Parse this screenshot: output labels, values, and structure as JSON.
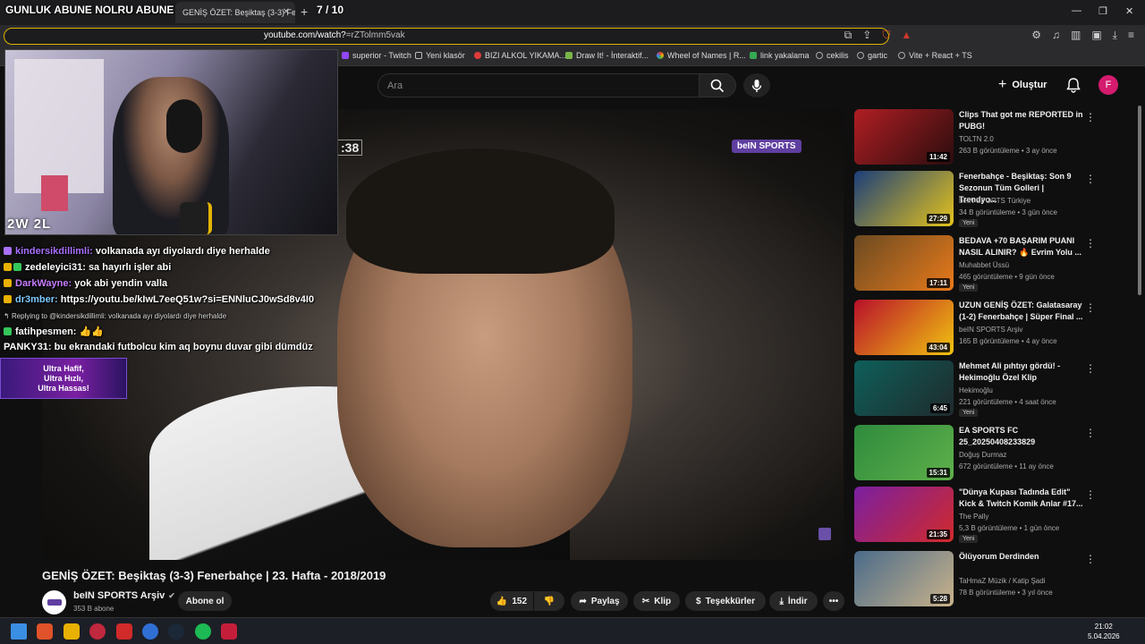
{
  "stream_overlay": {
    "title": "GUNLUK ABUNE NOLRU ABUNE",
    "counter": "7 / 10",
    "score": "2W  2L"
  },
  "browser": {
    "tab_title": "GENİŞ ÖZET: Beşiktaş (3-3) Fener",
    "url_host": "youtube.com/watch?",
    "url_rest": "=rZTolmm5vak"
  },
  "bookmarks": [
    {
      "label": "superior - Twitch",
      "color": "#9146ff"
    },
    {
      "label": "Yeni klasör",
      "color": "#888888"
    },
    {
      "label": "BIZI ALKOL YIKAMA...",
      "color": "#e03a3a"
    },
    {
      "label": "Draw It! - İnteraktif...",
      "color": "#7ab648"
    },
    {
      "label": "Wheel of Names | R...",
      "color": "#e8b000"
    },
    {
      "label": "link yakalama",
      "color": "#34a853"
    },
    {
      "label": "cekilis",
      "color": "#aaaaaa"
    },
    {
      "label": "gartic",
      "color": "#aaaaaa"
    },
    {
      "label": "Vite + React + TS",
      "color": "#aaaaaa"
    }
  ],
  "header": {
    "search_placeholder": "Ara",
    "create_label": "Oluştur",
    "avatar_letter": "F"
  },
  "player": {
    "channel_logo": "beIN SPORTS",
    "timecode": ":38"
  },
  "chat": [
    {
      "name": "kindersikdillimli:",
      "msg": "volkanada ayı diyolardı diye herhalde",
      "color": "#a970ff"
    },
    {
      "name": "zedeleyici31:",
      "msg": "sa hayırlı işler abi",
      "color": "#ffffff"
    },
    {
      "name": "DarkWayne:",
      "msg": "yok abi yendin valla",
      "color": "#c77dff"
    },
    {
      "name": "dr3mber:",
      "msg": "https://youtu.be/kIwL7eeQ51w?si=ENNluCJ0wSd8v4I0",
      "color": "#7ec8ff"
    },
    {
      "name": "",
      "msg": "Replying to @kindersikdillimli: volkanada ayı diyolardı diye herhalde",
      "color": "#dddddd"
    },
    {
      "name": "fatihpesmen:",
      "msg": "👍👍",
      "color": "#ffffff"
    },
    {
      "name": "PANKY31:",
      "msg": "bu ekrandaki futbolcu kim aq boynu duvar gibi dümdüz",
      "color": "#ffffff"
    }
  ],
  "ad_text": [
    "Ultra Hafif,",
    "Ultra Hızlı,",
    "Ultra Hassas!"
  ],
  "video": {
    "title": "GENİŞ ÖZET: Beşiktaş (3-3) Fenerbahçe | 23. Hafta - 2018/2019",
    "channel": "beIN SPORTS Arşiv",
    "subs": "353 B abone",
    "subscribe": "Abone ol",
    "likes": "152",
    "share": "Paylaş",
    "clip": "Klip",
    "thanks": "Teşekkürler",
    "download": "İndir"
  },
  "recommendations": [
    {
      "title": "Clips That got me REPORTED in PUBG!",
      "channel": "TOLTN 2.0",
      "meta": "263 B görüntüleme • 3 ay önce",
      "duration": "11:42",
      "new": "",
      "c1": "#b01e23",
      "c2": "#2a0d0e"
    },
    {
      "title": "Fenerbahçe - Beşiktaş: Son 9 Sezonun Tüm Golleri | Trendyo...",
      "channel": "beIN SPORTS Türkiye",
      "meta": "34 B görüntüleme • 3 gün önce",
      "duration": "27:29",
      "new": "Yeni",
      "c1": "#1b3e7a",
      "c2": "#e5c31b"
    },
    {
      "title": "BEDAVA +70 BAŞARIM PUANI NASIL ALINIR? 🔥 Evrim Yolu ...",
      "channel": "Muhabbet Üssü",
      "meta": "465 görüntüleme • 9 gün önce",
      "duration": "17:11",
      "new": "Yeni",
      "c1": "#6b4a22",
      "c2": "#e87a1a"
    },
    {
      "title": "UZUN GENİŞ ÖZET: Galatasaray (1-2) Fenerbahçe | Süper Final ...",
      "channel": "beIN SPORTS Arşiv",
      "meta": "165 B görüntüleme • 4 ay önce",
      "duration": "43:04",
      "new": "",
      "c1": "#b8102b",
      "c2": "#f1c40f"
    },
    {
      "title": "Mehmet Ali pıhtıyı gördü! - Hekimoğlu Özel Klip",
      "channel": "Hekimoğlu",
      "meta": "221 görüntüleme • 4 saat önce",
      "duration": "6:45",
      "new": "Yeni",
      "c1": "#0e5f5a",
      "c2": "#1f2a2c"
    },
    {
      "title": "EA SPORTS FC 25_20250408233829",
      "channel": "Doğuş Durmaz",
      "meta": "672 görüntüleme • 11 ay önce",
      "duration": "15:31",
      "new": "",
      "c1": "#2e8b3d",
      "c2": "#5fb04a"
    },
    {
      "title": "\"Dünya Kupası Tadında Edit\" Kick & Twitch Komik Anlar #17...",
      "channel": "The Pally",
      "meta": "5,3 B görüntüleme • 1 gün önce",
      "duration": "21:35",
      "new": "Yeni",
      "c1": "#7a1fa2",
      "c2": "#d12a2a"
    },
    {
      "title": "Ölüyorum Derdinden",
      "channel": "TaHmaZ Müzik / Katip Şadi",
      "meta": "78 B görüntüleme • 3 yıl önce",
      "duration": "5:28",
      "new": "",
      "c1": "#4a6b8a",
      "c2": "#c9b28a"
    }
  ],
  "taskbar": {
    "time": "21:02",
    "date": "5.04.2026"
  }
}
